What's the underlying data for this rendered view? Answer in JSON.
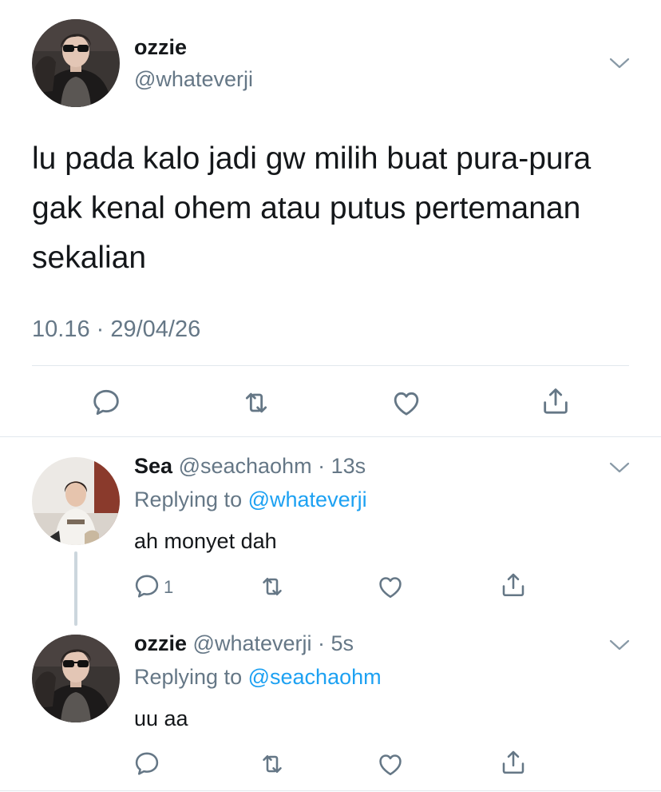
{
  "main_tweet": {
    "name": "ozzie",
    "handle": "@whateverji",
    "text": "lu pada kalo jadi gw milih buat pura-pura gak kenal ohem atau putus pertemanan sekalian",
    "timestamp": "10.16 · 29/04/26",
    "icons": [
      "reply-icon",
      "retweet-icon",
      "like-icon",
      "share-icon"
    ]
  },
  "replies": [
    {
      "name": "Sea",
      "handle": "@seachaohm",
      "time": "13s",
      "replying_prefix": "Replying to",
      "replying_to": "@whateverji",
      "text": "ah monyet dah",
      "reply_count": "1"
    },
    {
      "name": "ozzie",
      "handle": "@whateverji",
      "time": "5s",
      "replying_prefix": "Replying to",
      "replying_to": "@seachaohm",
      "text": "uu aa",
      "reply_count": ""
    }
  ],
  "colors": {
    "text": "#14171a",
    "secondary": "#657786",
    "link": "#1da1f2",
    "divider": "#e1e8ed",
    "thread_line": "#ccd6dd"
  }
}
